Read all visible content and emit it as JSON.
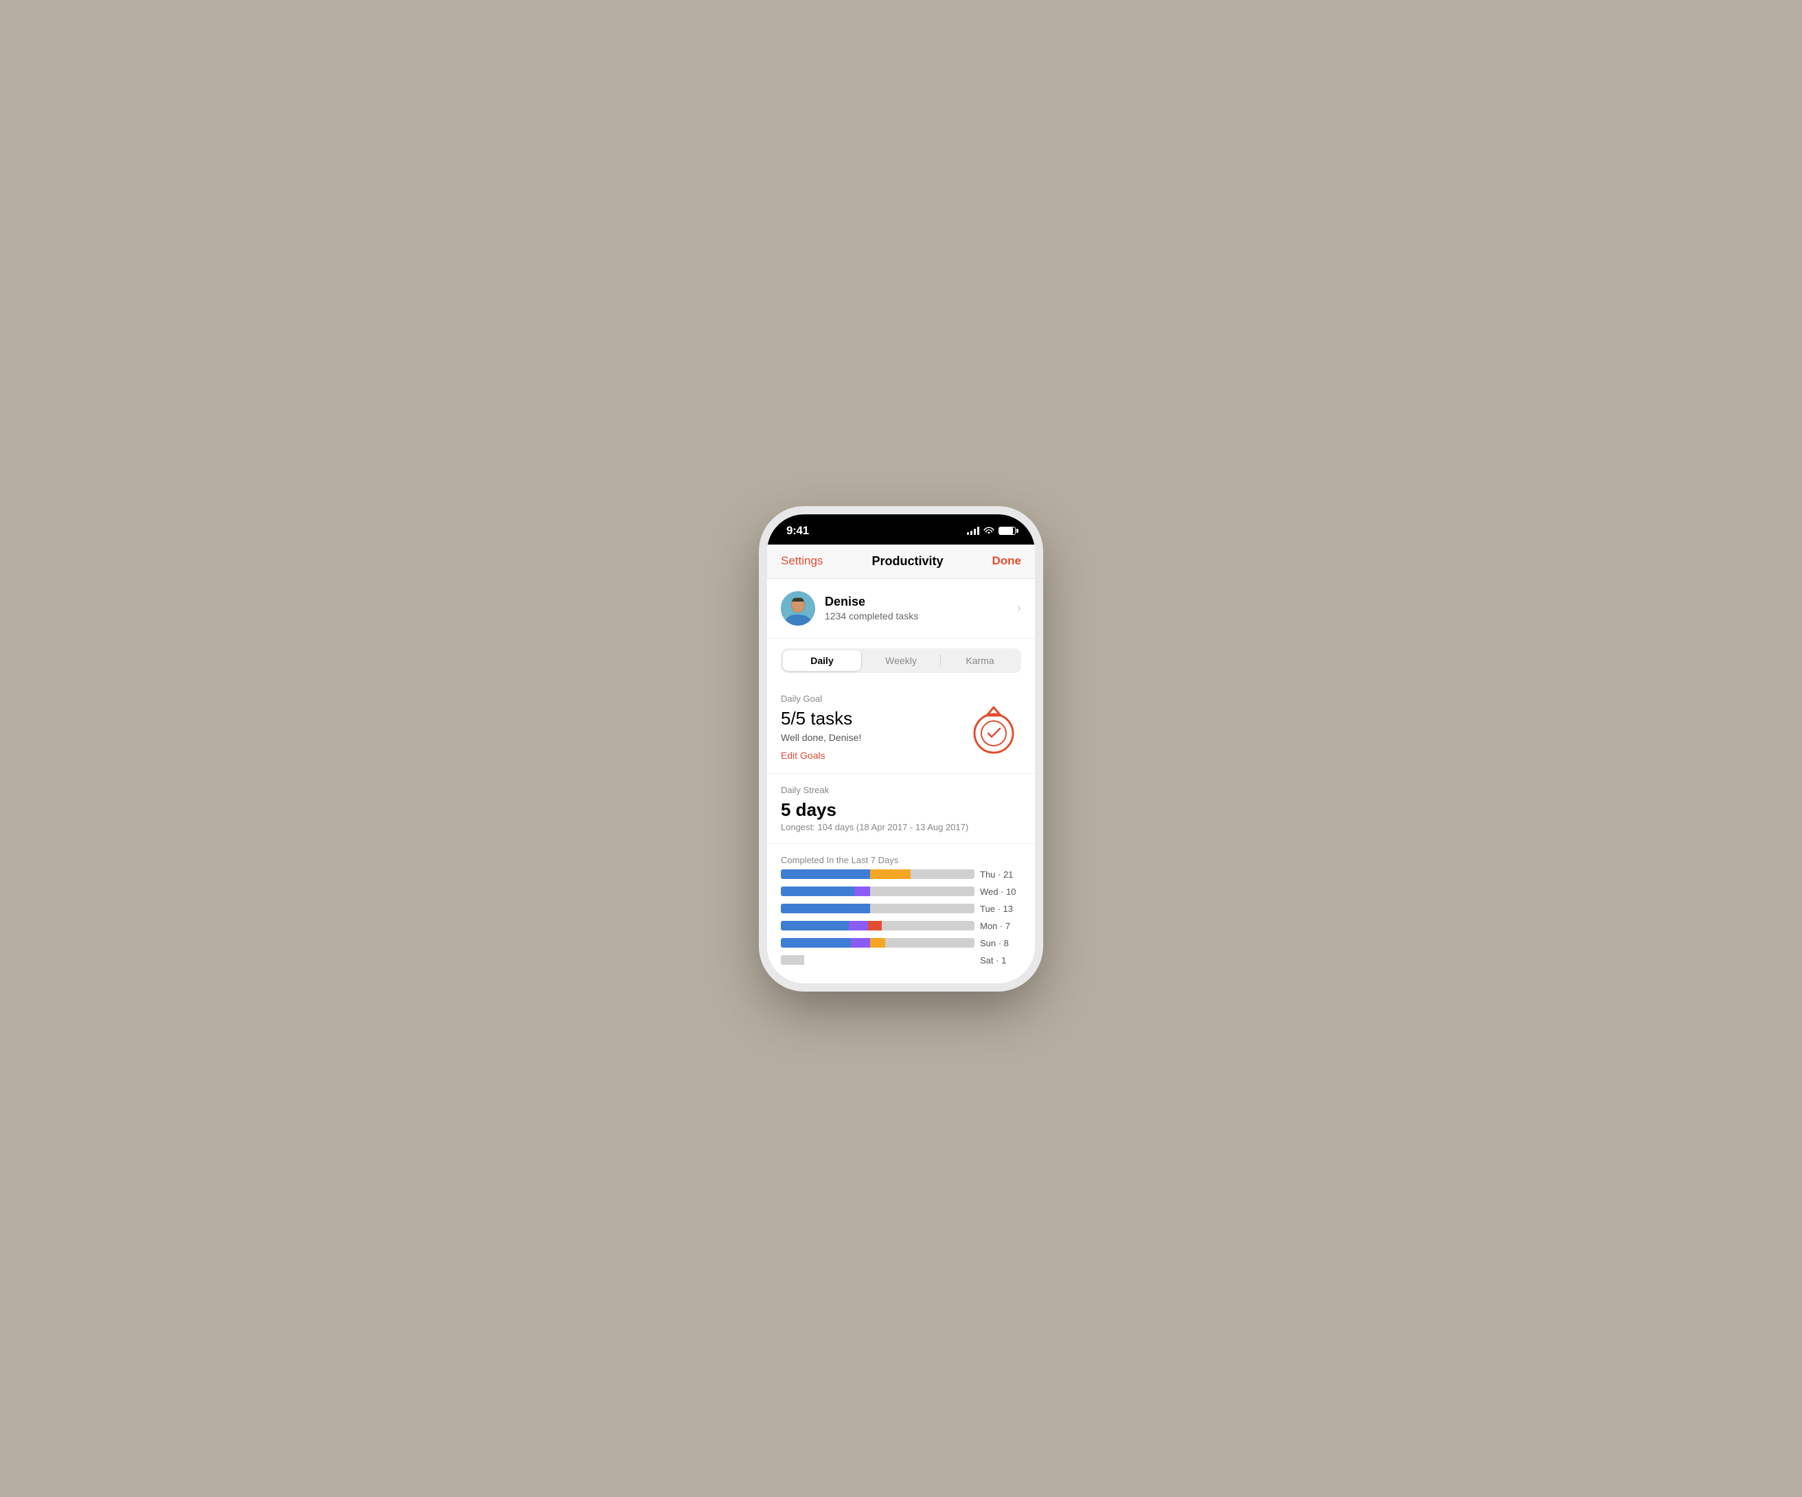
{
  "statusBar": {
    "time": "9:41"
  },
  "nav": {
    "settings_label": "Settings",
    "title": "Productivity",
    "done_label": "Done"
  },
  "user": {
    "name": "Denise",
    "tasks_label": "1234 completed tasks",
    "avatar_emoji": "👤"
  },
  "tabs": [
    {
      "id": "daily",
      "label": "Daily",
      "active": true
    },
    {
      "id": "weekly",
      "label": "Weekly",
      "active": false
    },
    {
      "id": "karma",
      "label": "Karma",
      "active": false
    }
  ],
  "dailyGoal": {
    "section_label": "Daily Goal",
    "value": "5/5",
    "tasks_suffix": " tasks",
    "subtitle": "Well done, Denise!",
    "edit_link": "Edit Goals"
  },
  "dailyStreak": {
    "section_label": "Daily Streak",
    "value": "5 days",
    "longest": "Longest: 104 days (18 Apr 2017 - 13 Aug 2017)"
  },
  "completedSection": {
    "section_label": "Completed In the Last 7 Days",
    "bars": [
      {
        "day": "Thu · 21",
        "segments": [
          {
            "type": "blue",
            "pct": 46
          },
          {
            "type": "orange",
            "pct": 21
          },
          {
            "type": "gray",
            "pct": 33
          }
        ]
      },
      {
        "day": "Wed · 10",
        "segments": [
          {
            "type": "blue",
            "pct": 38
          },
          {
            "type": "purple",
            "pct": 8
          },
          {
            "type": "gray",
            "pct": 54
          }
        ]
      },
      {
        "day": "Tue · 13",
        "segments": [
          {
            "type": "blue",
            "pct": 46
          },
          {
            "type": "gray",
            "pct": 54
          }
        ]
      },
      {
        "day": "Mon · 7",
        "segments": [
          {
            "type": "blue",
            "pct": 35
          },
          {
            "type": "purple",
            "pct": 10
          },
          {
            "type": "red",
            "pct": 7
          },
          {
            "type": "gray",
            "pct": 48
          }
        ]
      },
      {
        "day": "Sun · 8",
        "segments": [
          {
            "type": "blue",
            "pct": 36
          },
          {
            "type": "purple",
            "pct": 10
          },
          {
            "type": "orange",
            "pct": 8
          },
          {
            "type": "gray",
            "pct": 46
          }
        ]
      },
      {
        "day": "Sat · 1",
        "segments": [
          {
            "type": "gray",
            "pct": 12
          }
        ]
      }
    ]
  },
  "colors": {
    "accent": "#e44c30",
    "blue": "#3d7ed4",
    "orange": "#f5a623",
    "purple": "#8b5cf6",
    "red": "#e44c30",
    "gray": "#d0d0d0"
  }
}
